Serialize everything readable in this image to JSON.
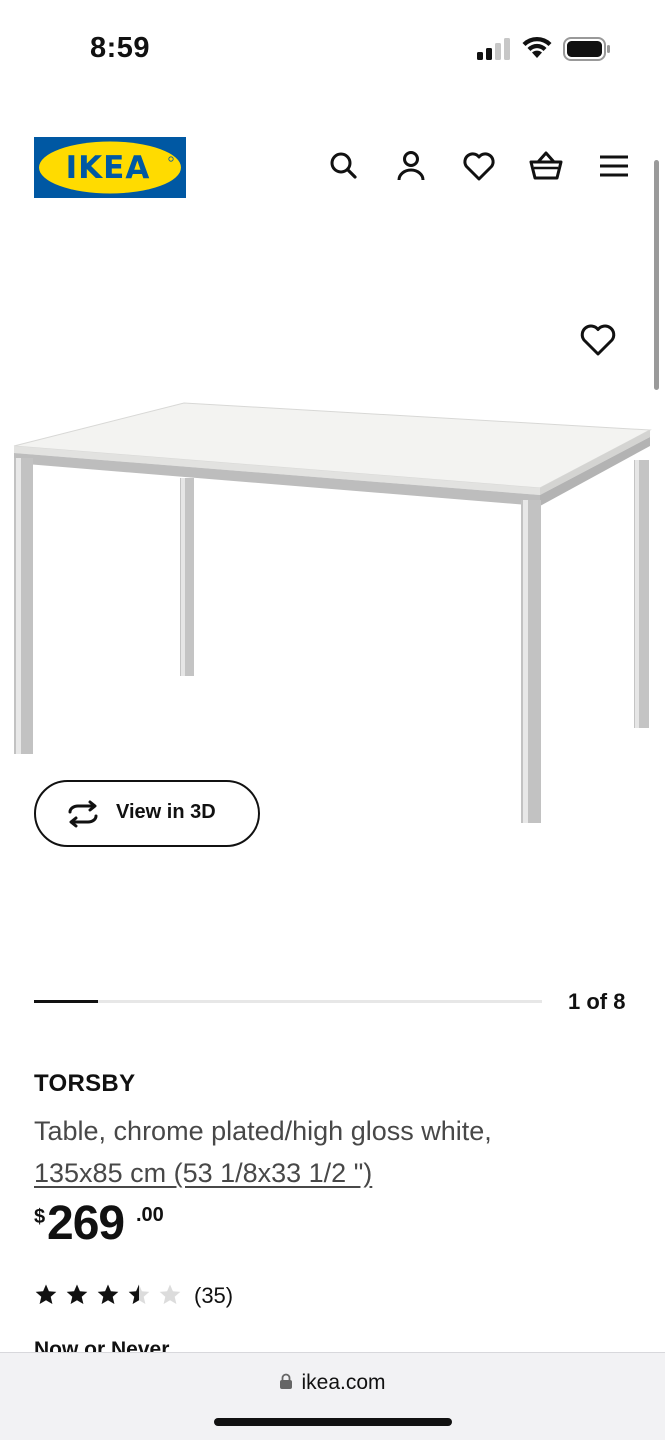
{
  "status_bar": {
    "time": "8:59"
  },
  "header": {
    "logo_text": "IKEA",
    "brand_colors": {
      "blue": "#0058A3",
      "yellow": "#FFDB00"
    },
    "icons": [
      "search-icon",
      "user-icon",
      "heart-icon",
      "cart-icon",
      "menu-icon"
    ]
  },
  "gallery": {
    "view_3d_label": "View in 3D",
    "counter": "1 of 8",
    "current": 1,
    "total": 8
  },
  "product": {
    "name": "TORSBY",
    "description": "Table, chrome plated/high gloss white,",
    "size": "135x85 cm (53 1/8x33 1/2 \")",
    "price": {
      "currency": "$",
      "integer": "269",
      "decimal": ".00"
    },
    "rating": {
      "value": 3.5,
      "max": 5,
      "count": "(35)"
    },
    "promo_label": "Now or Never"
  },
  "browser": {
    "url": "ikea.com"
  }
}
